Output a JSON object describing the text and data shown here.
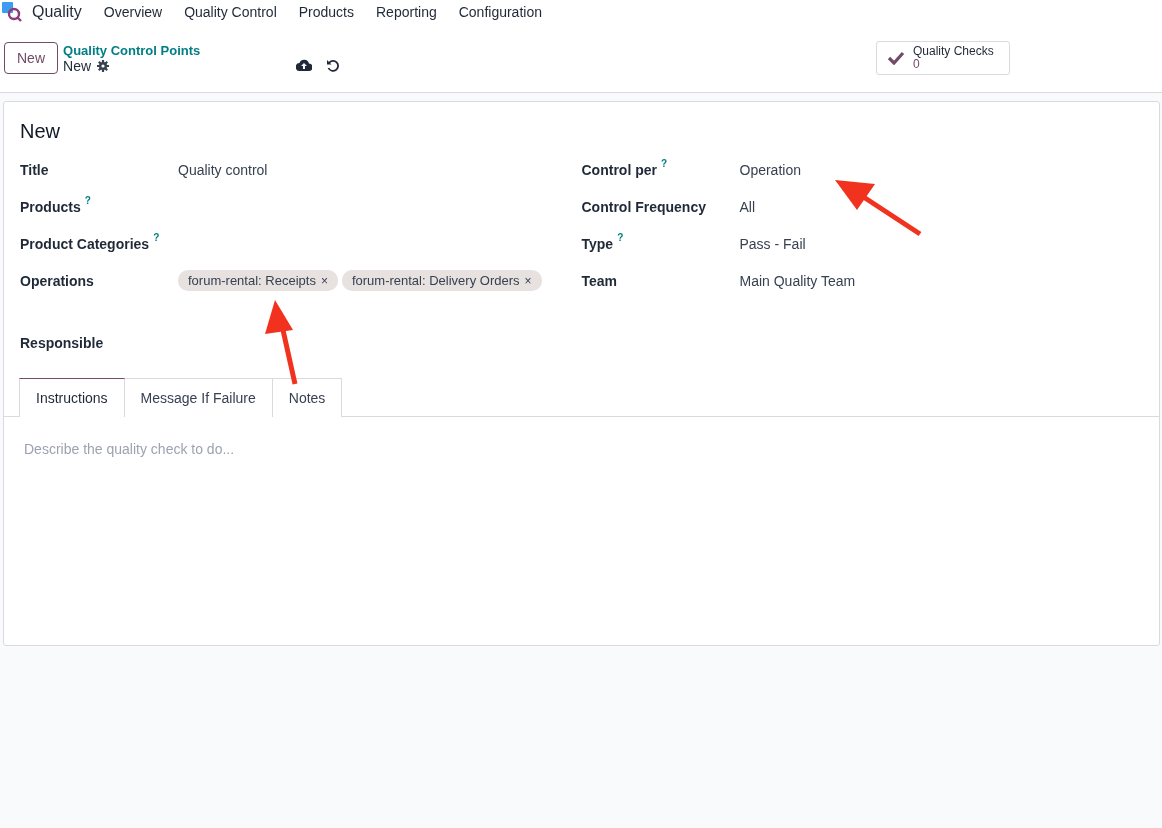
{
  "navbar": {
    "app_name": "Quality",
    "menu": [
      "Overview",
      "Quality Control",
      "Products",
      "Reporting",
      "Configuration"
    ]
  },
  "control_panel": {
    "new_button": "New",
    "breadcrumb": "Quality Control Points",
    "record": "New",
    "smart_button": {
      "label": "Quality Checks",
      "count": "0"
    }
  },
  "form": {
    "title": "New",
    "left_fields": [
      {
        "label": "Title",
        "kind": "text",
        "value": "Quality control"
      },
      {
        "label": "Products",
        "help": "?",
        "kind": "empty"
      },
      {
        "label": "Product Categories",
        "help": "?",
        "kind": "empty"
      },
      {
        "label": "Operations",
        "kind": "tags",
        "tags": [
          {
            "label": "forum-rental: Receipts",
            "remove": "×"
          },
          {
            "label": "forum-rental: Delivery Orders",
            "remove": "×"
          }
        ]
      },
      {
        "label": "Responsible",
        "kind": "empty"
      }
    ],
    "right_fields": [
      {
        "label": "Control per",
        "help": "?",
        "kind": "text",
        "value": "Operation"
      },
      {
        "label": "Control Frequency",
        "kind": "text",
        "value": "All"
      },
      {
        "label": "Type",
        "help": "?",
        "kind": "text",
        "value": "Pass - Fail"
      },
      {
        "label": "Team",
        "kind": "text",
        "value": "Main Quality Team"
      }
    ],
    "tabs": [
      {
        "label": "Instructions",
        "selected": true
      },
      {
        "label": "Message If Failure",
        "selected": false
      },
      {
        "label": "Notes",
        "selected": false
      }
    ],
    "editor": {
      "placeholder": "Describe the quality check to do..."
    }
  }
}
